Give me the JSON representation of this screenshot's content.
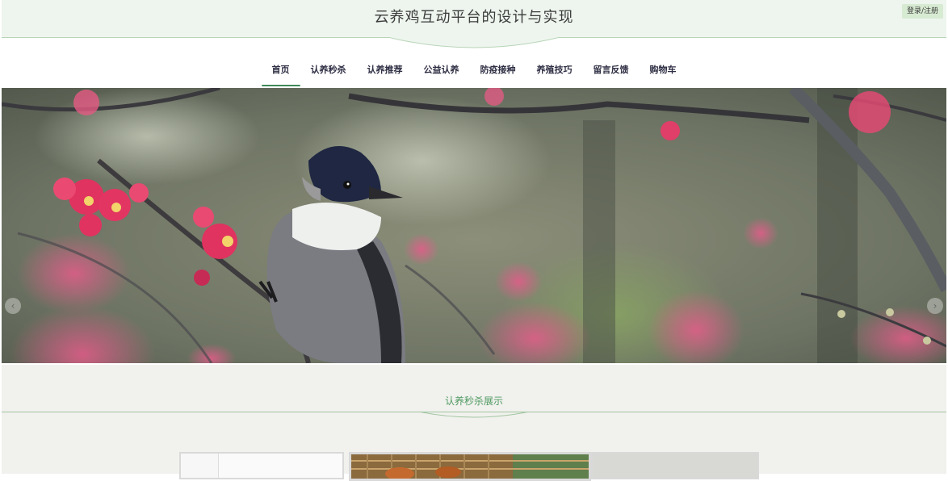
{
  "header": {
    "title": "云养鸡互动平台的设计与实现",
    "login_label": "登录/注册"
  },
  "nav": {
    "items": [
      {
        "label": "首页"
      },
      {
        "label": "认养秒杀"
      },
      {
        "label": "认养推荐"
      },
      {
        "label": "公益认养"
      },
      {
        "label": "防疫接种"
      },
      {
        "label": "养殖技巧"
      },
      {
        "label": "留言反馈"
      },
      {
        "label": "购物车"
      }
    ],
    "active_index": 0
  },
  "banner": {
    "slide_count": 3,
    "active_slide": 2
  },
  "section": {
    "title": "认养秒杀展示"
  },
  "colors": {
    "accent": "#3f8a5a",
    "header_bg": "#eef5ee",
    "section_title": "#4f9a60"
  },
  "icons": {
    "prev": "chevron-left-icon",
    "next": "chevron-right-icon"
  }
}
